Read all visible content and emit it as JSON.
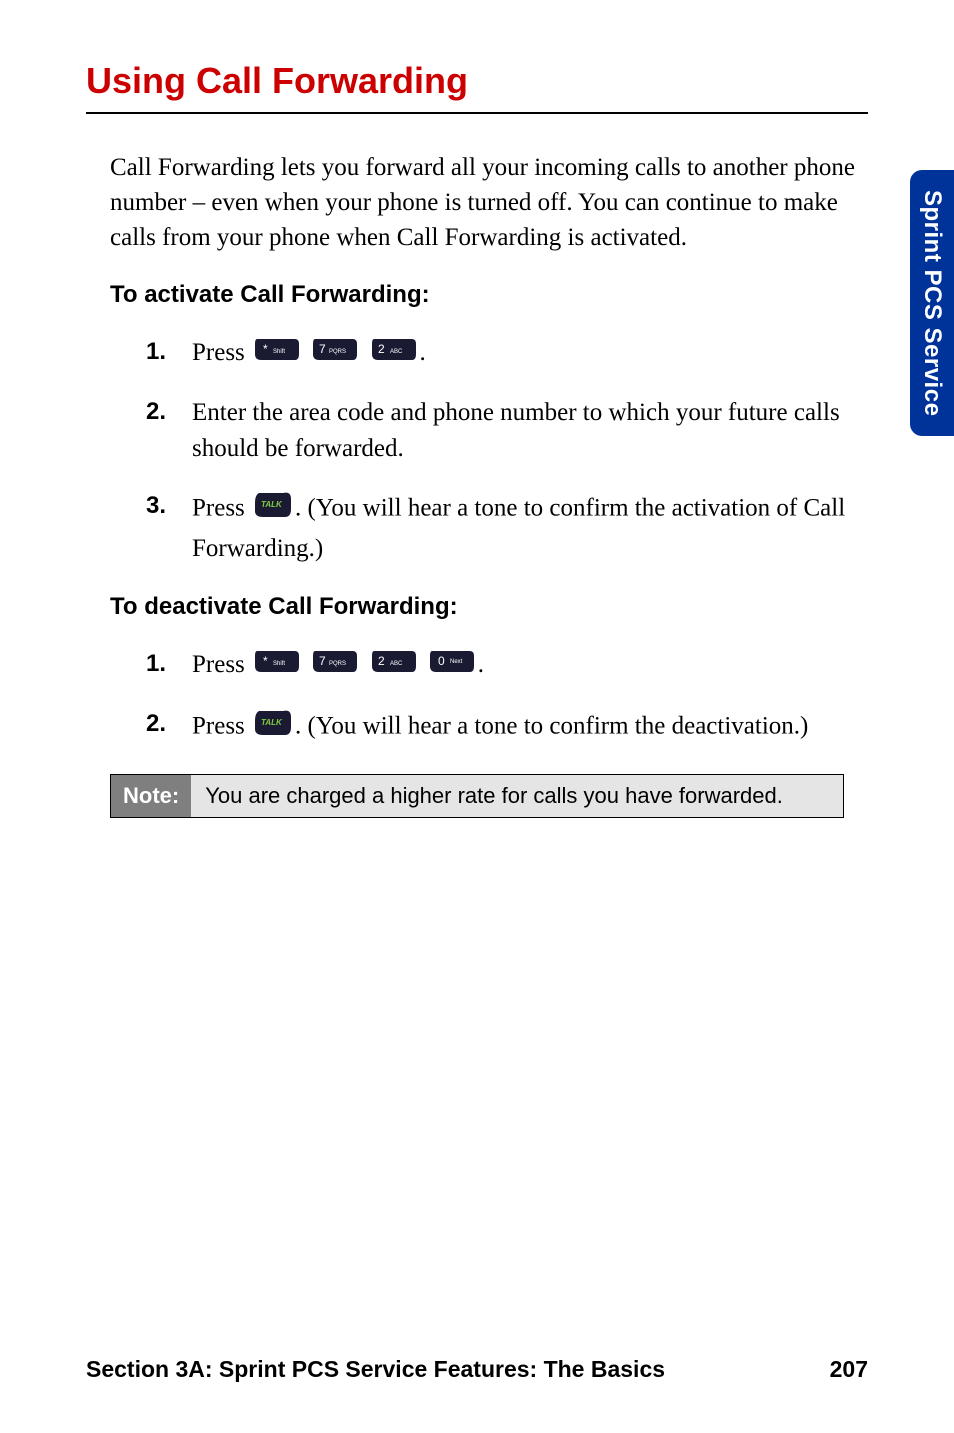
{
  "heading": "Using Call Forwarding",
  "intro": "Call Forwarding lets you forward all your incoming calls to another phone number – even when your phone is turned off. You can continue to make calls from your phone when Call Forwarding is activated.",
  "activate_heading": "To activate Call Forwarding:",
  "activate_steps": {
    "s1": {
      "num": "1.",
      "pre": "Press ",
      "post": "."
    },
    "s2": {
      "num": "2.",
      "text": "Enter the area code and phone number to which your future calls should be forwarded."
    },
    "s3": {
      "num": "3.",
      "pre": "Press ",
      "post": ". (You will hear a tone to confirm the activation of Call Forwarding.)"
    }
  },
  "deactivate_heading": "To deactivate Call Forwarding:",
  "deactivate_steps": {
    "s1": {
      "num": "1.",
      "pre": "Press ",
      "post": "."
    },
    "s2": {
      "num": "2.",
      "pre": "Press ",
      "post": ". (You will hear a tone to confirm the deactivation.)"
    }
  },
  "note": {
    "label": "Note:",
    "text": "You are charged a higher rate for calls you have forwarded."
  },
  "side_tab": "Sprint PCS Service",
  "footer": {
    "section": "Section 3A: Sprint PCS Service Features: The Basics",
    "page": "207"
  },
  "key_labels": {
    "star": "* Shift",
    "seven": "7 PQRS",
    "two": "2 ABC",
    "zero": "0",
    "talk": "TALK"
  }
}
